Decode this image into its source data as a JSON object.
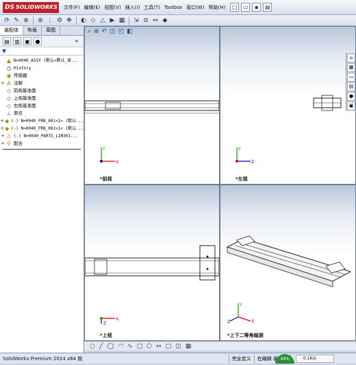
{
  "app": {
    "logo_text": "SOLIDWORKS",
    "logo_mark": "DS"
  },
  "menu": {
    "items": [
      "文件(F)",
      "编辑(E)",
      "视图(V)",
      "插入(I)",
      "工具(T)",
      "Toolbox",
      "窗口(W)",
      "帮助(H)"
    ]
  },
  "left_panel": {
    "tabs": [
      "装配体",
      "布局",
      "草图"
    ],
    "tree": [
      {
        "label": "N=0040_ASSY (默认<默认_显...",
        "icon": "assembly-icon",
        "exp": "",
        "mono": true
      },
      {
        "label": "History",
        "icon": "history-icon",
        "exp": "",
        "mono": true
      },
      {
        "label": "传感器",
        "icon": "sensor-icon",
        "exp": "",
        "mono": false
      },
      {
        "label": "注解",
        "icon": "annotation-icon",
        "exp": "+",
        "mono": false
      },
      {
        "label": "前视基准面",
        "icon": "plane-icon",
        "exp": "",
        "mono": false
      },
      {
        "label": "上视基准面",
        "icon": "plane-icon",
        "exp": "",
        "mono": false
      },
      {
        "label": "右视基准面",
        "icon": "plane-icon",
        "exp": "",
        "mono": false
      },
      {
        "label": "原点",
        "icon": "origin-icon",
        "exp": "",
        "mono": false
      },
      {
        "label": "(-) N=0040_FRB_001<1> (默认...",
        "icon": "part-icon",
        "exp": "+",
        "mono": true
      },
      {
        "label": "(-) N=0040_FRB_002<1> (默认...",
        "icon": "part-icon",
        "exp": "+",
        "mono": true
      },
      {
        "label": "(-) N=0040_PARTS_LIM301...",
        "icon": "subassembly-warning-icon",
        "exp": "+",
        "mono": true
      },
      {
        "label": "配合",
        "icon": "mates-icon",
        "exp": "+",
        "mono": false
      }
    ]
  },
  "viewports": {
    "front": {
      "label": "*前视"
    },
    "left": {
      "label": "*左视"
    },
    "top": {
      "label": "*上视"
    },
    "iso": {
      "label": "*上下二等角轴测"
    }
  },
  "status": {
    "product": "SolidWorks Premium 2014 x64 版",
    "definition": "完全定义",
    "mode": "在编辑 装配体",
    "cpu_gauge": "49%",
    "net_speed": "0.1K/s"
  }
}
